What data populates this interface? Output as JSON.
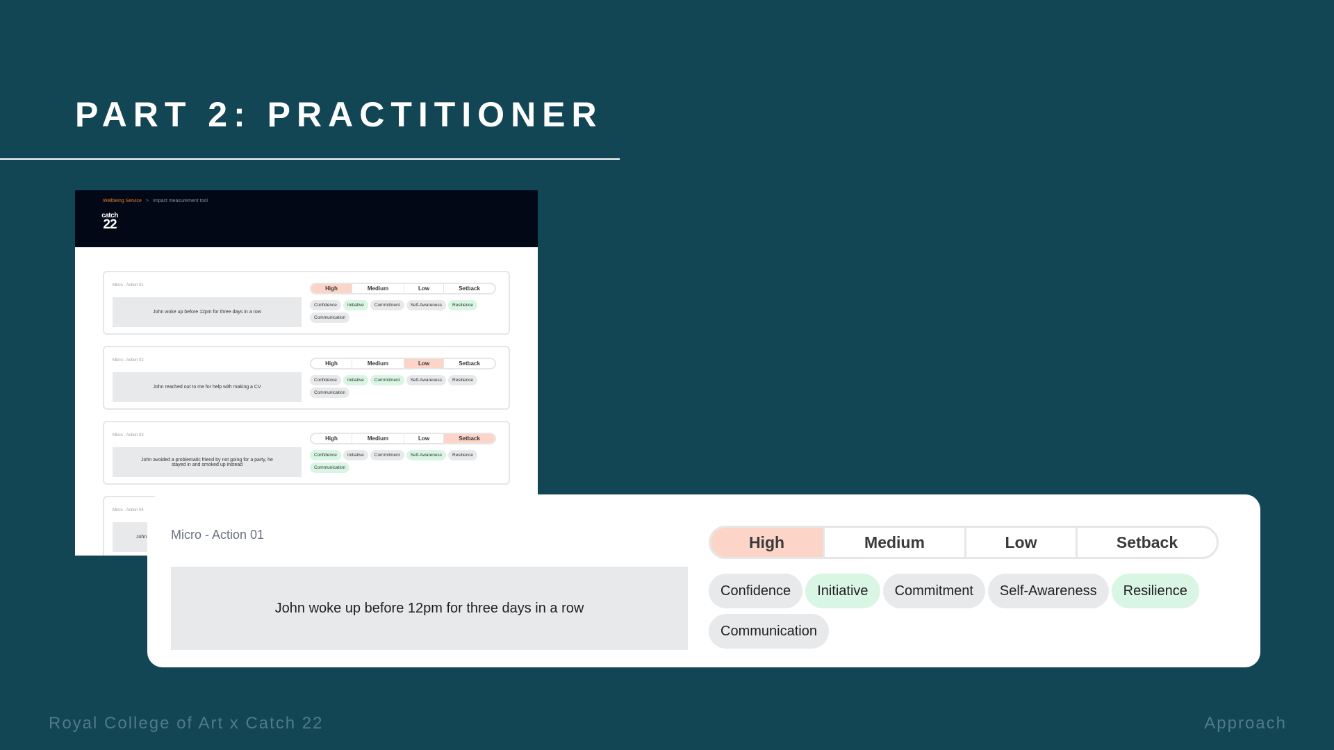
{
  "slide": {
    "title": "PART 2: PRACTITIONER",
    "footer_left": "Royal College of Art x Catch 22",
    "footer_right": "Approach"
  },
  "app": {
    "breadcrumb": [
      "Wellbeing Service",
      ">",
      "Impact measurement tool"
    ],
    "logo_top": "catch",
    "logo_num": "22",
    "levels": [
      "High",
      "Medium",
      "Low",
      "Setback"
    ],
    "skills": [
      "Confidence",
      "Initiative",
      "Commitment",
      "Self-Awareness",
      "Resilience",
      "Communication"
    ],
    "cards": [
      {
        "label": "Micro - Action 01",
        "text": "John woke up before 12pm for three days in a row",
        "selected_level": "High",
        "highlighted_skills": [
          "Initiative",
          "Resilience"
        ]
      },
      {
        "label": "Micro - Action 02",
        "text": "John reached out to me for help with making a CV",
        "selected_level": "Low",
        "highlighted_skills": [
          "Initiative",
          "Commitment"
        ]
      },
      {
        "label": "Micro - Action 03",
        "text": "John avoided a problematic friend by not going for a party, he stayed in and smoked up instead",
        "selected_level": "Setback",
        "highlighted_skills": [
          "Confidence",
          "Self-Awareness",
          "Communication"
        ]
      },
      {
        "label": "Micro - Action 04",
        "text": "John a"
      }
    ]
  },
  "zoom": {
    "label": "Micro - Action 01",
    "text": "John woke up before 12pm for three days in a row",
    "levels": [
      "High",
      "Medium",
      "Low",
      "Setback"
    ],
    "selected_level": "High",
    "skills": [
      "Confidence",
      "Initiative",
      "Commitment",
      "Self-Awareness",
      "Resilience",
      "Communication"
    ],
    "highlighted_skills": [
      "Initiative",
      "Resilience"
    ]
  },
  "colors": {
    "background": "#124655",
    "selected_level": "#fcd5c8",
    "highlighted_skill": "#d9f5e3",
    "chip": "#e8e9eb",
    "breadcrumb_accent": "#e67b2e"
  }
}
